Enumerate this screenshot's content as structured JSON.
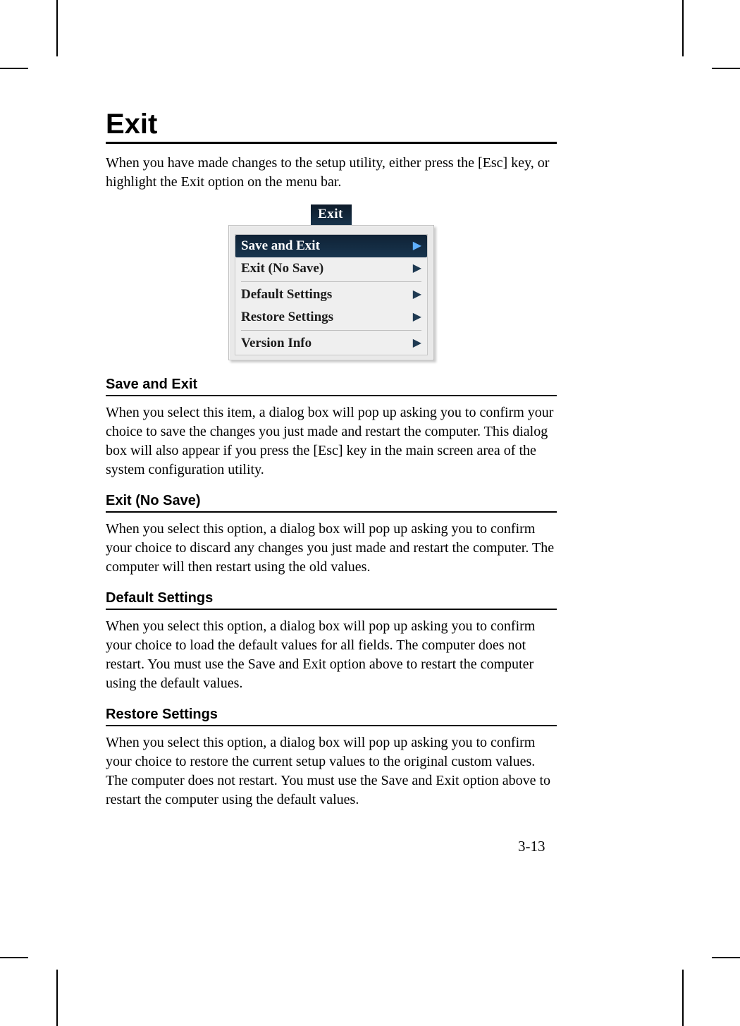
{
  "title": "Exit",
  "intro": "When you have made changes to the setup utility, either press the [Esc] key, or highlight the Exit option on the menu bar.",
  "menu": {
    "tab": "Exit",
    "items": [
      {
        "label": "Save and Exit",
        "selected": true
      },
      {
        "label": "Exit (No Save)",
        "selected": false
      },
      {
        "label": "Default Settings",
        "selected": false
      },
      {
        "label": "Restore Settings",
        "selected": false
      },
      {
        "label": "Version Info",
        "selected": false
      }
    ]
  },
  "sections": [
    {
      "heading": "Save and Exit",
      "body": "When you select this item, a dialog box will pop up asking you to confirm your choice to save the changes you just made and restart the computer. This dialog box will also appear if you press the [Esc] key in the main screen area of the system configuration utility."
    },
    {
      "heading": "Exit (No Save)",
      "body": "When you select this option, a dialog box will pop up asking you to confirm your choice to discard any changes you just made and restart the computer. The computer will then restart using the old values."
    },
    {
      "heading": "Default Settings",
      "body": "When you select this option, a dialog box will pop up asking you to confirm your choice to load the default values for all fields. The computer does not restart. You must use the Save and Exit option above to restart the computer using the default values."
    },
    {
      "heading": "Restore Settings",
      "body": "When you select this option, a dialog box will pop up asking you to confirm your choice to restore the current setup values to the original custom values. The computer does not restart. You must use the Save and Exit option above to restart the computer using the default values."
    }
  ],
  "page_number": "3-13"
}
